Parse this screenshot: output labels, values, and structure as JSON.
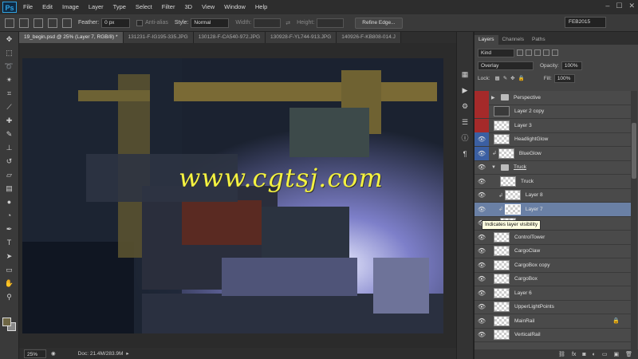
{
  "menubar": {
    "logo": "Ps",
    "items": [
      "File",
      "Edit",
      "Image",
      "Layer",
      "Type",
      "Select",
      "Filter",
      "3D",
      "View",
      "Window",
      "Help"
    ]
  },
  "options": {
    "feather_label": "Feather:",
    "feather_value": "0 px",
    "antialias_label": "Anti-alias",
    "style_label": "Style:",
    "style_value": "Normal",
    "width_label": "Width:",
    "height_label": "Height:",
    "refine_button": "Refine Edge...",
    "workspace": "FEB2015"
  },
  "tabs": [
    {
      "label": "19_begin.psd @ 25% (Layer 7, RGB/8) *"
    },
    {
      "label": "131231-F-IG195-335.JPG"
    },
    {
      "label": "130128-F-CA540-972.JPG"
    },
    {
      "label": "130928-F-YL744-913.JPG"
    },
    {
      "label": "140926-F-KB808-014.J"
    }
  ],
  "watermark": "www.cgtsj.com",
  "status": {
    "zoom": "25%",
    "doc": "Doc: 21.4M/283.9M"
  },
  "layers_panel": {
    "tabs": [
      "Layers",
      "Channels",
      "Paths"
    ],
    "kind_label": "Kind",
    "blend_mode": "Overlay",
    "opacity_label": "Opacity:",
    "opacity_value": "100%",
    "lock_label": "Lock:",
    "fill_label": "Fill:",
    "fill_value": "100%",
    "layers": [
      {
        "name": "Perspective",
        "type": "folder",
        "mark": "red"
      },
      {
        "name": "Layer 2 copy",
        "type": "layer",
        "mark": "red"
      },
      {
        "name": "Layer 3",
        "type": "layer",
        "mark": "red"
      },
      {
        "name": "HeadlightGlow",
        "type": "layer",
        "mark": "blue"
      },
      {
        "name": "BlueGlow",
        "type": "layer",
        "mark": "blue"
      },
      {
        "name": "Truck",
        "type": "folder-open"
      },
      {
        "name": "Truck",
        "type": "layer"
      },
      {
        "name": "Layer 8",
        "type": "layer"
      },
      {
        "name": "Layer 7",
        "type": "layer",
        "selected": true
      },
      {
        "name": "",
        "type": "layer"
      },
      {
        "name": "ControlTower",
        "type": "layer"
      },
      {
        "name": "CargoClaw",
        "type": "layer"
      },
      {
        "name": "CargoBox copy",
        "type": "layer"
      },
      {
        "name": "CargoBox",
        "type": "layer"
      },
      {
        "name": "Layer 6",
        "type": "layer"
      },
      {
        "name": "UpperLightPoints",
        "type": "layer"
      },
      {
        "name": "MainRail",
        "type": "layer",
        "locked": true
      },
      {
        "name": "VerticalRail",
        "type": "layer"
      }
    ]
  },
  "tooltip": "Indicates layer visibility",
  "colors": {
    "selected": "#6a80a5",
    "mark_red": "#a52a2a",
    "mark_blue": "#3b5fa2",
    "watermark": "#f4f240"
  }
}
